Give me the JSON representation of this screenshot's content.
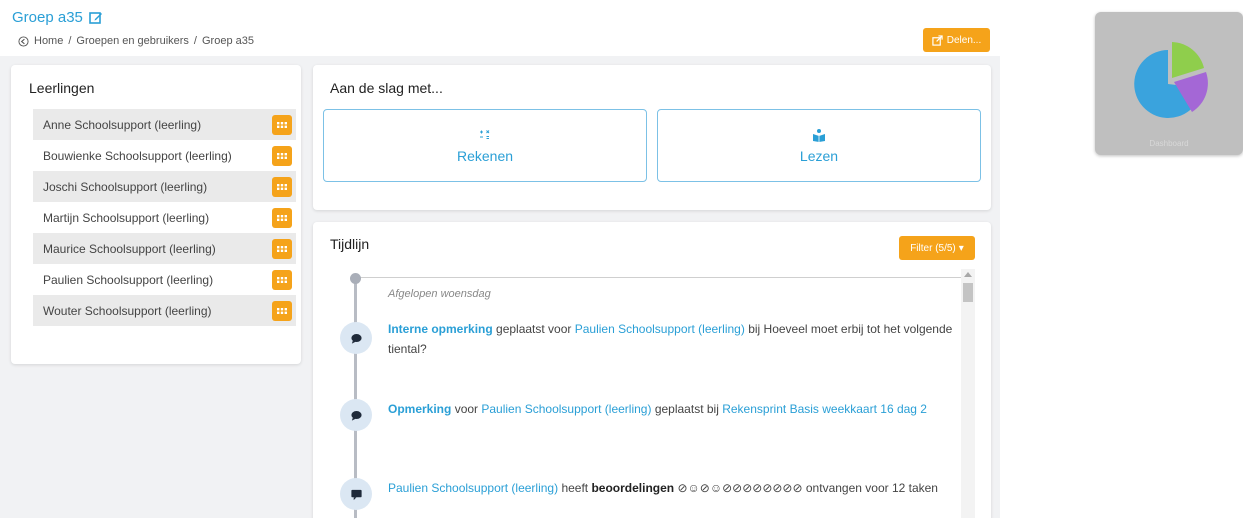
{
  "header": {
    "title": "Groep a35",
    "breadcrumb": [
      "Home",
      "Groepen en gebruikers",
      "Groep a35"
    ],
    "share_label": "Delen..."
  },
  "students": {
    "heading": "Leerlingen",
    "items": [
      "Anne Schoolsupport (leerling)",
      "Bouwienke Schoolsupport (leerling)",
      "Joschi Schoolsupport (leerling)",
      "Martijn Schoolsupport (leerling)",
      "Maurice Schoolsupport (leerling)",
      "Paulien Schoolsupport (leerling)",
      "Wouter Schoolsupport (leerling)"
    ]
  },
  "start": {
    "heading": "Aan de slag met...",
    "tiles": [
      "Rekenen",
      "Lezen"
    ]
  },
  "timeline": {
    "heading": "Tijdlijn",
    "filter_label": "Filter (5/5)",
    "day_label": "Afgelopen woensdag",
    "entries": [
      {
        "type_label": "Interne opmerking",
        "text1": " geplaatst voor ",
        "student": "Paulien Schoolsupport (leerling)",
        "text2": " bij Hoeveel moet erbij tot het volgende tiental?"
      },
      {
        "type_label": "Opmerking",
        "text1": " voor ",
        "student": "Paulien Schoolsupport (leerling)",
        "text2": " geplaatst bij ",
        "target": "Rekensprint Basis weekkaart 16 dag 2"
      },
      {
        "student": "Paulien Schoolsupport (leerling)",
        "text1": " heeft ",
        "bold": "beoordelingen",
        "ratings": "⊘☺⊘☺⊘⊘⊘⊘⊘⊘⊘⊘",
        "text2": " ontvangen voor 12 taken"
      }
    ]
  },
  "thumbnail": {
    "caption": "Dashboard",
    "colors": {
      "blue": "#3aa3dd",
      "green": "#8fce4c",
      "purple": "#a467d6"
    }
  },
  "colors": {
    "accent": "#2a9fd6",
    "orange": "#f5a31a"
  }
}
